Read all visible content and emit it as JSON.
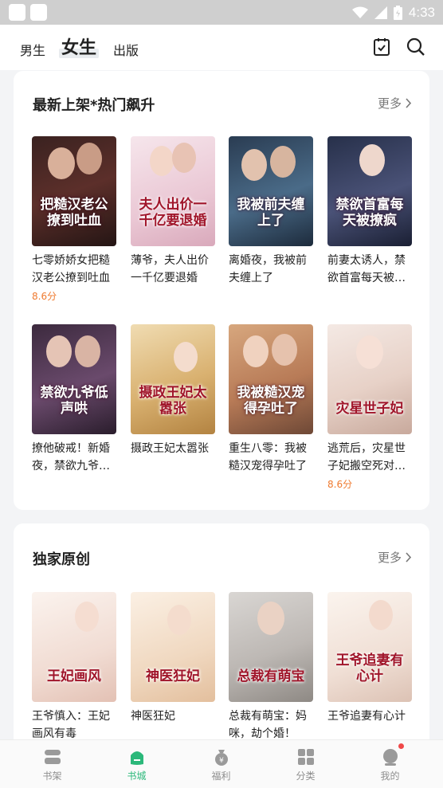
{
  "status_bar": {
    "time": "4:33"
  },
  "header": {
    "tabs": [
      {
        "label": "男生",
        "active": false
      },
      {
        "label": "女生",
        "active": true
      },
      {
        "label": "出版",
        "active": false
      }
    ]
  },
  "sections": [
    {
      "title": "最新上架*热门飙升",
      "more": "更多",
      "books": [
        {
          "title": "七零娇娇女把糙汉老公撩到吐血",
          "score": "8.6分",
          "cover_text": "把糙汉老公撩到吐血"
        },
        {
          "title": "薄爷，夫人出价一千亿要退婚",
          "score": "",
          "cover_text": "夫人出价一千亿要退婚"
        },
        {
          "title": "离婚夜，我被前夫缠上了",
          "score": "",
          "cover_text": "我被前夫缠上了"
        },
        {
          "title": "前妻太诱人，禁欲首富每天被…",
          "score": "",
          "cover_text": "禁欲首富每天被撩疯"
        },
        {
          "title": "撩他破戒！新婚夜，禁欲九爷…",
          "score": "",
          "cover_text": "禁欲九爷低声哄"
        },
        {
          "title": "摄政王妃太嚣张",
          "score": "",
          "cover_text": "摄政王妃太嚣张"
        },
        {
          "title": "重生八零：我被糙汉宠得孕吐了",
          "score": "",
          "cover_text": "我被糙汉宠得孕吐了"
        },
        {
          "title": "逃荒后，灾星世子妃搬空死对…",
          "score": "8.6分",
          "cover_text": "灾星世子妃"
        }
      ]
    },
    {
      "title": "独家原创",
      "more": "更多",
      "books": [
        {
          "title": "王爷慎入：王妃画风有毒",
          "score": "",
          "cover_text": "王妃画风"
        },
        {
          "title": "神医狂妃",
          "score": "",
          "cover_text": "神医狂妃"
        },
        {
          "title": "总裁有萌宝：妈咪，劫个婚！",
          "score": "",
          "cover_text": "总裁有萌宝"
        },
        {
          "title": "王爷追妻有心计",
          "score": "",
          "cover_text": "王爷追妻有心计"
        }
      ]
    }
  ],
  "bottom_nav": [
    {
      "label": "书架",
      "icon": "bookshelf-icon",
      "active": false
    },
    {
      "label": "书城",
      "icon": "bookstore-icon",
      "active": true
    },
    {
      "label": "福利",
      "icon": "gift-bag-icon",
      "active": false
    },
    {
      "label": "分类",
      "icon": "category-grid-icon",
      "active": false
    },
    {
      "label": "我的",
      "icon": "profile-icon",
      "active": false,
      "badge": true
    }
  ],
  "colors": {
    "accent": "#2bb87a",
    "score": "#ef7a2f",
    "badge": "#f04848"
  }
}
